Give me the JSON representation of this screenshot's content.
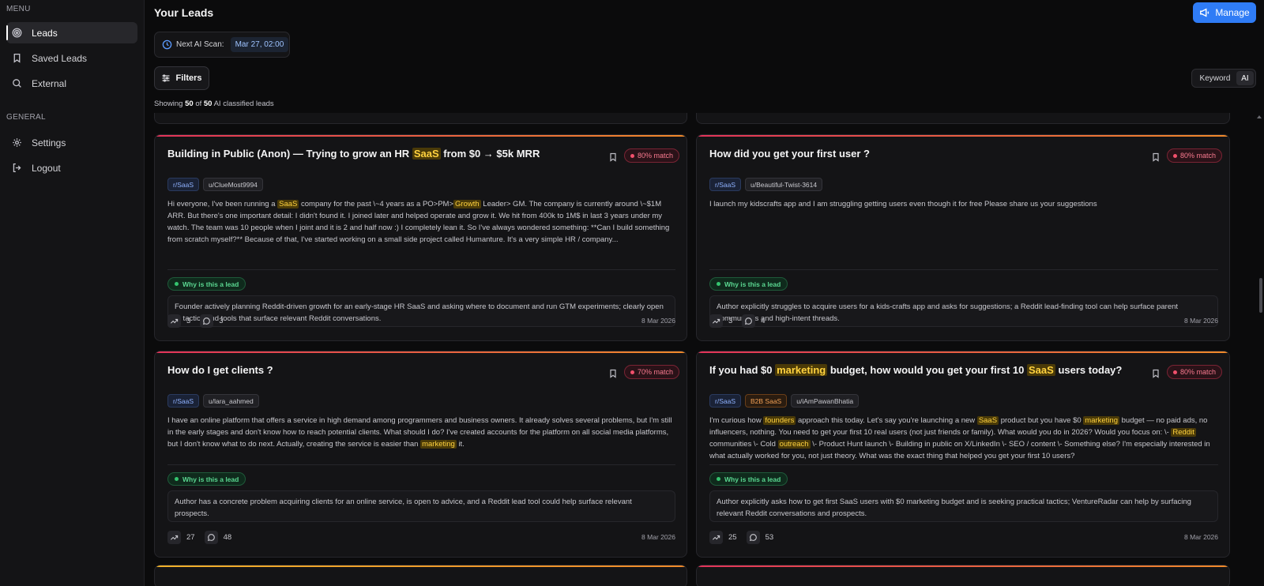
{
  "sidebar": {
    "menu_label": "MENU",
    "general_label": "GENERAL",
    "menu_items": [
      {
        "label": "Leads",
        "icon": "target-icon"
      },
      {
        "label": "Saved Leads",
        "icon": "bookmark-icon"
      },
      {
        "label": "External",
        "icon": "search-icon"
      }
    ],
    "general_items": [
      {
        "label": "Settings",
        "icon": "gear-icon"
      },
      {
        "label": "Logout",
        "icon": "logout-icon"
      }
    ]
  },
  "header": {
    "title": "Your Leads",
    "manage_label": "Manage",
    "scan_label": "Next AI Scan:",
    "scan_date": "Mar 27, 02:00",
    "filters_label": "Filters",
    "toggle_keyword": "Keyword",
    "toggle_ai": "AI",
    "showing_prefix": "Showing",
    "showing_count": "50",
    "showing_of": "of",
    "showing_total": "50",
    "showing_suffix": "AI classified leads"
  },
  "leads": [
    {
      "title_parts": [
        "Building in Public (Anon) — Trying to grow an HR ",
        "SaaS",
        " from $0 → $5k MRR"
      ],
      "match": "80% match",
      "subreddit": "r/SaaS",
      "user": "u/ClueMost9994",
      "body_parts": [
        "Hi everyone, I've been running a ",
        "SaaS",
        " company for the past \\~4 years as a PO>PM>",
        "Growth",
        " Leader> GM. The company is currently around \\~$1M ARR. But there's one important detail: I didn't found it. I joined later and helped operate and grow it. We hit from 400k to 1M$ in last 3 years under my watch. The team was 10 people when I joint and it is 2 and half now :) I completely lean it. So I've always wondered something: **Can I build something from scratch myself?** Because of that, I've started working on a small side project called Humanture. It's a very simple HR / company..."
      ],
      "why_label": "Why is this a lead",
      "reason": "Founder actively planning Reddit-driven growth for an early-stage HR SaaS and asking where to document and run GTM experiments; clearly open to tactics and tools that surface relevant Reddit conversations.",
      "upvotes": "3",
      "comments": "3",
      "date": "8 Mar 2026"
    },
    {
      "title_parts": [
        "How did you get your first user ?"
      ],
      "match": "80% match",
      "subreddit": "r/SaaS",
      "user": "u/Beautiful-Twist-3614",
      "body_parts": [
        "I launch my kidscrafts app and I am struggling getting users even though it for free Please share us your suggestions"
      ],
      "why_label": "Why is this a lead",
      "reason": "Author explicitly struggles to acquire users for a kids-crafts app and asks for suggestions; a Reddit lead-finding tool can help surface parent communities and high-intent threads.",
      "upvotes": "3",
      "comments": "4",
      "date": "8 Mar 2026"
    },
    {
      "title_parts": [
        "How do I get clients ?"
      ],
      "match": "70% match",
      "subreddit": "r/SaaS",
      "user": "u/lara_aahmed",
      "body_parts": [
        "I have an online platform that offers a service in high demand among programmers and business owners. It already solves several problems, but I'm still in the early stages and don't know how to reach potential clients. What should I do? I've created accounts for the platform on all social media platforms, but I don't know what to do next. Actually, creating the service is easier than ",
        "marketing",
        " it."
      ],
      "why_label": "Why is this a lead",
      "reason": "Author has a concrete problem acquiring clients for an online service, is open to advice, and a Reddit lead tool could help surface relevant prospects.",
      "upvotes": "27",
      "comments": "48",
      "date": "8 Mar 2026"
    },
    {
      "title_parts": [
        "If you had $0 ",
        "marketing",
        " budget, how would you get your first 10 ",
        "SaaS",
        " users today?"
      ],
      "match": "80% match",
      "subreddit": "r/SaaS",
      "extra_tag": "B2B SaaS",
      "user": "u/iAmPawanBhatia",
      "body_parts": [
        "I'm curious how ",
        "founders",
        " approach this today. Let's say you're launching a new ",
        "SaaS",
        " product but you have $0 ",
        "marketing",
        " budget — no paid ads, no influencers, nothing. You need to get your first 10 real users (not just friends or family). What would you do in 2026? Would you focus on: \\- ",
        "Reddit",
        " communities \\- Cold ",
        "outreach",
        " \\- Product Hunt launch \\- Building in public on X/LinkedIn \\- SEO / content \\- Something else? I'm especially interested in what actually worked for you, not just theory. What was the exact thing that helped you get your first 10 users?"
      ],
      "why_label": "Why is this a lead",
      "reason": "Author explicitly asks how to get first SaaS users with $0 marketing budget and is seeking practical tactics; VentureRadar can help by surfacing relevant Reddit conversations and prospects.",
      "upvotes": "25",
      "comments": "53",
      "date": "8 Mar 2026"
    }
  ]
}
